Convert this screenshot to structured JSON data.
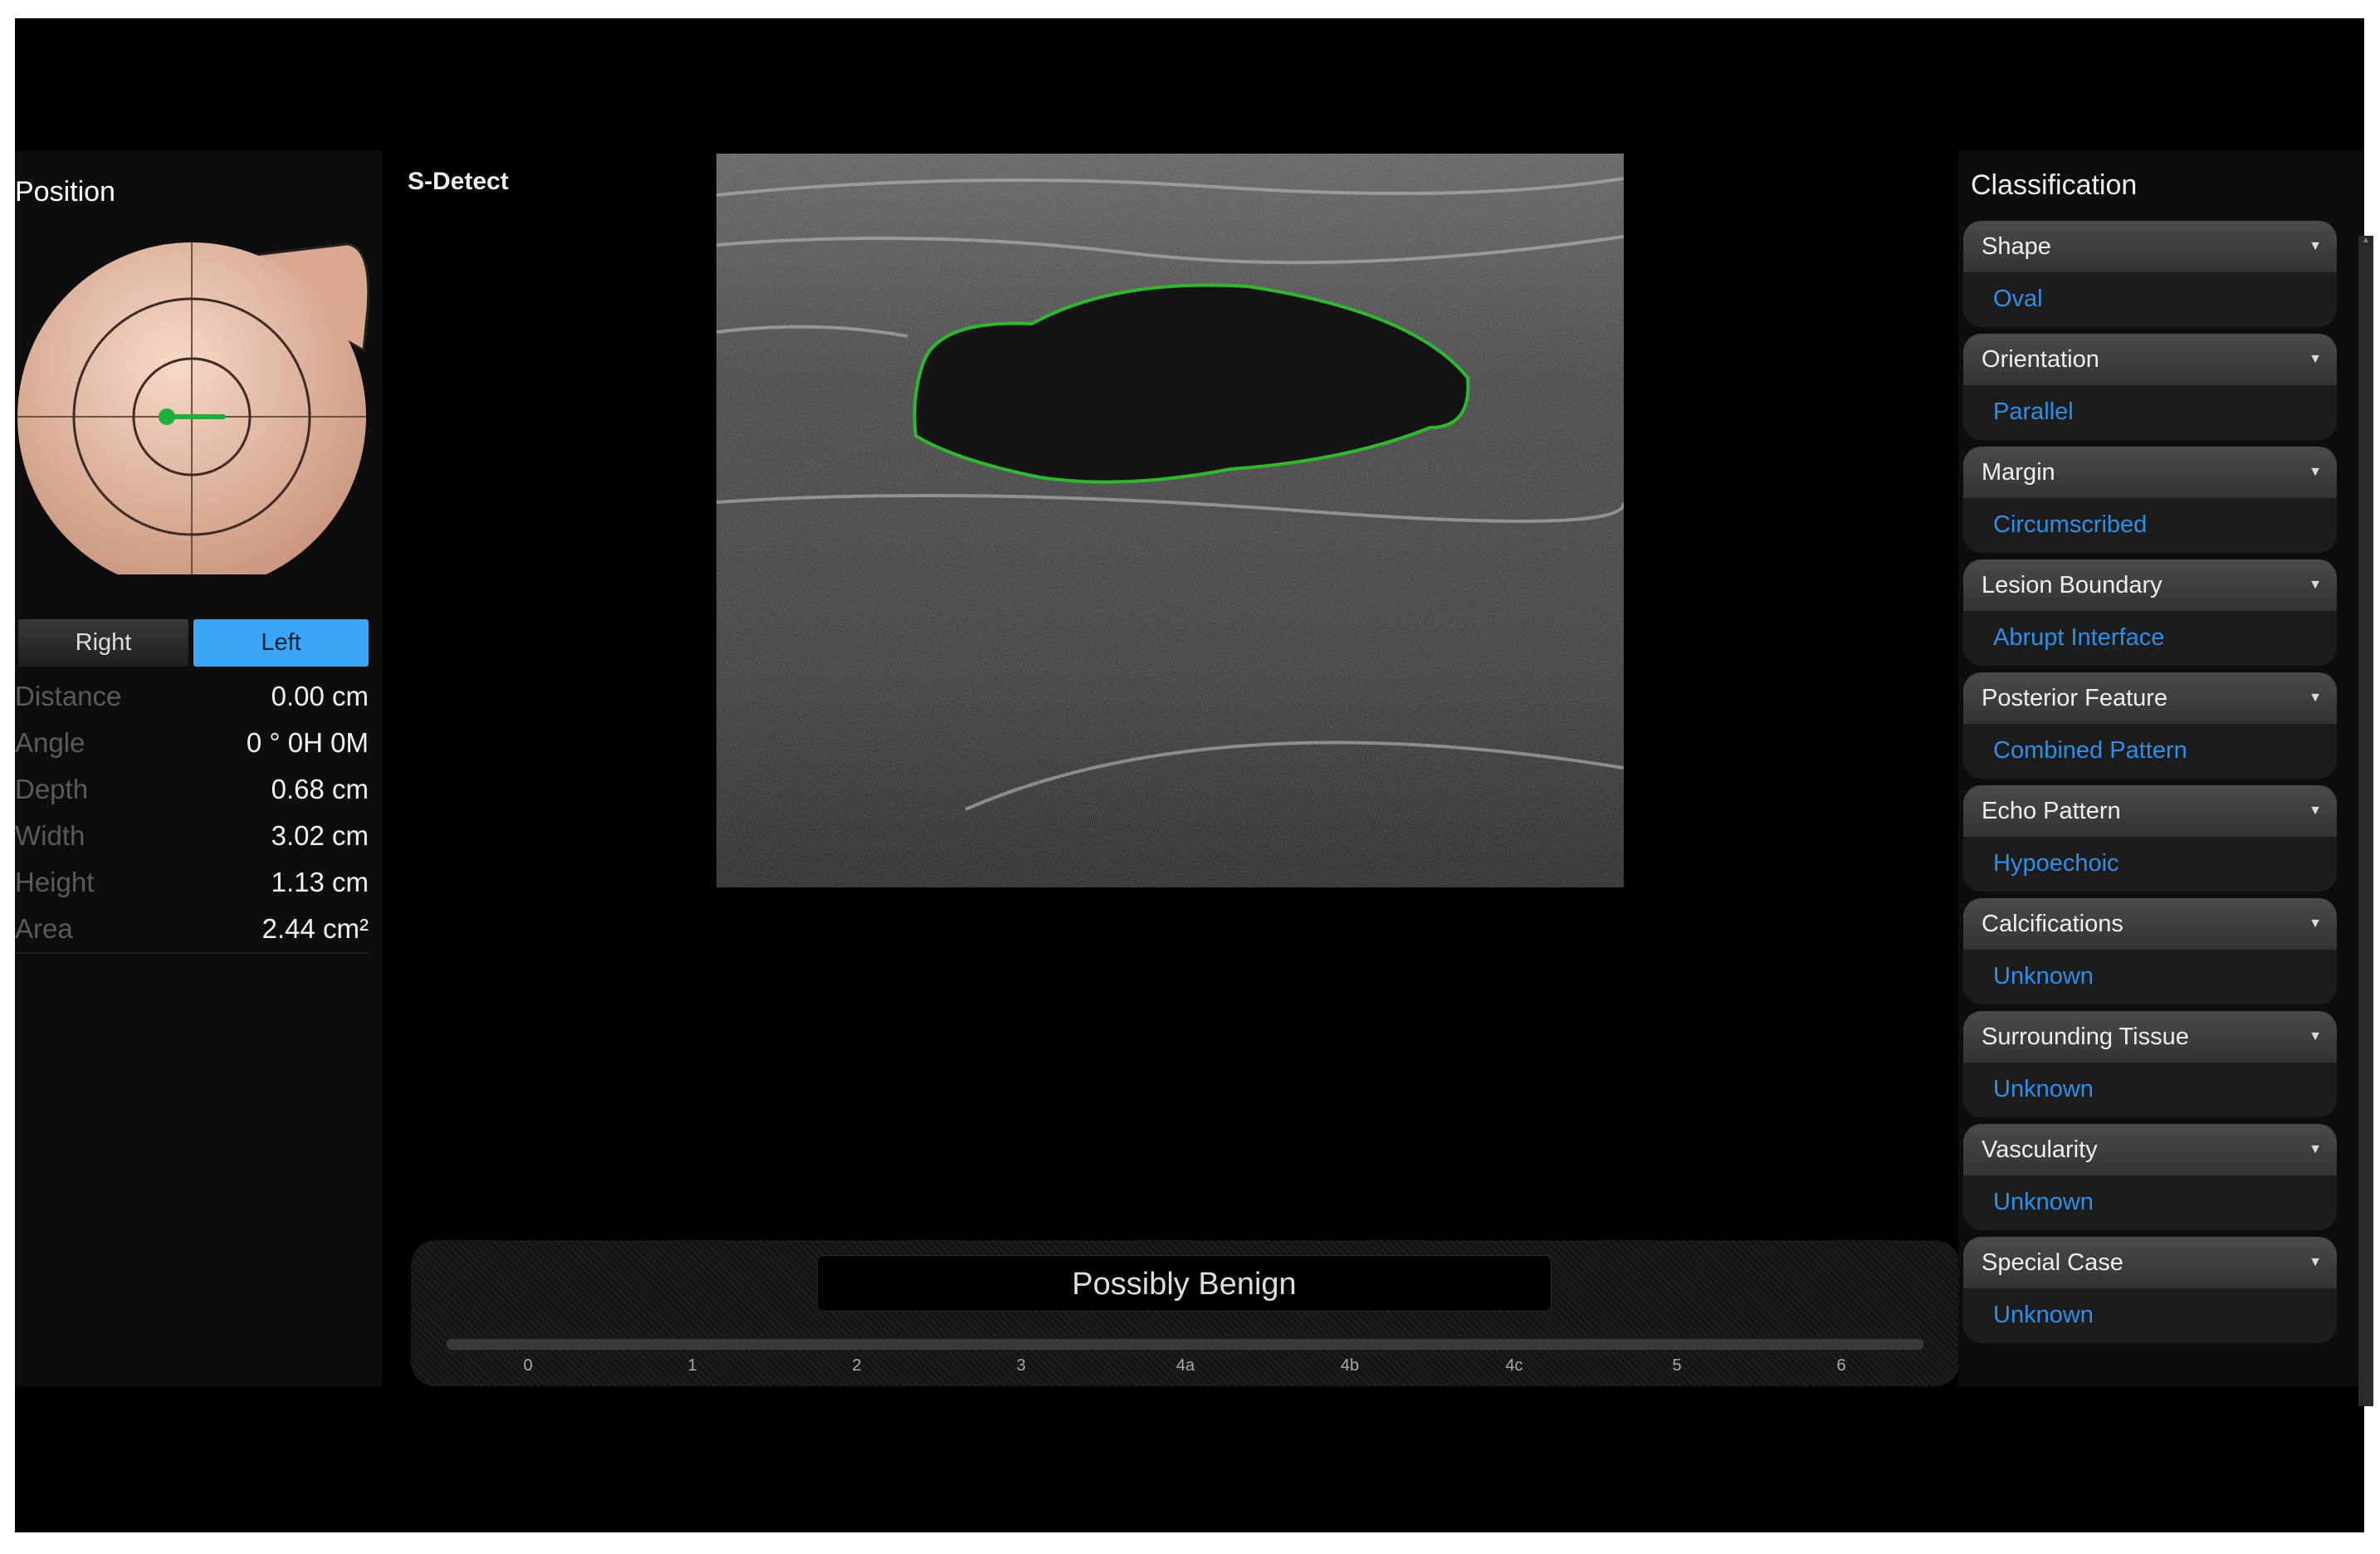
{
  "left": {
    "title": "Position",
    "side_buttons": {
      "right": "Right",
      "left": "Left"
    },
    "selected_side": "Left",
    "measurements": [
      {
        "label": "Distance",
        "value": "0.00 cm"
      },
      {
        "label": "Angle",
        "value": "0 ° 0H 0M"
      },
      {
        "label": "Depth",
        "value": "0.68 cm"
      },
      {
        "label": "Width",
        "value": "3.02 cm"
      },
      {
        "label": "Height",
        "value": "1.13 cm"
      },
      {
        "label": "Area",
        "value": "2.44 cm²"
      }
    ]
  },
  "center": {
    "title": "S-Detect",
    "result": "Possibly Benign",
    "scale_ticks": [
      "0",
      "1",
      "2",
      "3",
      "4a",
      "4b",
      "4c",
      "5",
      "6"
    ]
  },
  "right": {
    "title": "Classification",
    "items": [
      {
        "label": "Shape",
        "value": "Oval"
      },
      {
        "label": "Orientation",
        "value": "Parallel"
      },
      {
        "label": "Margin",
        "value": "Circumscribed"
      },
      {
        "label": "Lesion Boundary",
        "value": "Abrupt Interface"
      },
      {
        "label": "Posterior Feature",
        "value": "Combined Pattern"
      },
      {
        "label": "Echo Pattern",
        "value": "Hypoechoic"
      },
      {
        "label": "Calcifications",
        "value": "Unknown"
      },
      {
        "label": "Surrounding Tissue",
        "value": "Unknown"
      },
      {
        "label": "Vascularity",
        "value": "Unknown"
      },
      {
        "label": "Special Case",
        "value": "Unknown"
      }
    ]
  },
  "colors": {
    "accent": "#3aa6f5",
    "value_text": "#2f8fe6",
    "contour": "#2eb82e"
  }
}
